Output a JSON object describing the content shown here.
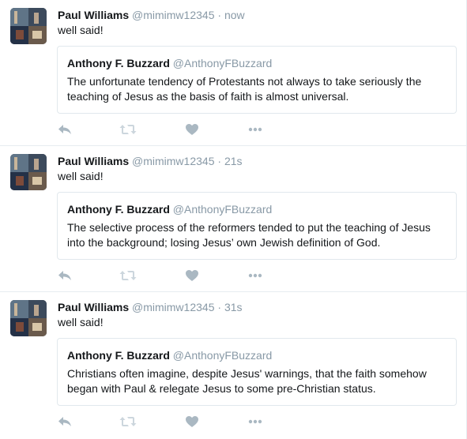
{
  "tweets": [
    {
      "name": "Paul Williams",
      "handle": "@mimimw12345",
      "separator": "·",
      "time": "now",
      "text": "well said!",
      "quote": {
        "name": "Anthony F. Buzzard",
        "handle": "@AnthonyFBuzzard",
        "text": "The unfortunate tendency of Protestants not always to take seriously the teaching of Jesus as the basis of faith is almost universal."
      }
    },
    {
      "name": "Paul Williams",
      "handle": "@mimimw12345",
      "separator": "·",
      "time": "21s",
      "text": "well said!",
      "quote": {
        "name": "Anthony F. Buzzard",
        "handle": "@AnthonyFBuzzard",
        "text": "The selective process of the reformers tended to put the teaching of Jesus into the background; losing Jesus’ own Jewish definition of God."
      }
    },
    {
      "name": "Paul Williams",
      "handle": "@mimimw12345",
      "separator": "·",
      "time": "31s",
      "text": "well said!",
      "quote": {
        "name": "Anthony F. Buzzard",
        "handle": "@AnthonyFBuzzard",
        "text": "Christians often imagine, despite Jesus' warnings, that the faith somehow began with Paul & relegate Jesus to some pre-Christian status."
      }
    }
  ],
  "icons": {
    "reply": "reply-icon",
    "retweet": "retweet-icon",
    "like": "heart-icon",
    "more": "more-icon"
  },
  "colors": {
    "action_icon": "#aab8c2",
    "muted_text": "#8899a6",
    "border": "#e1e8ed"
  }
}
